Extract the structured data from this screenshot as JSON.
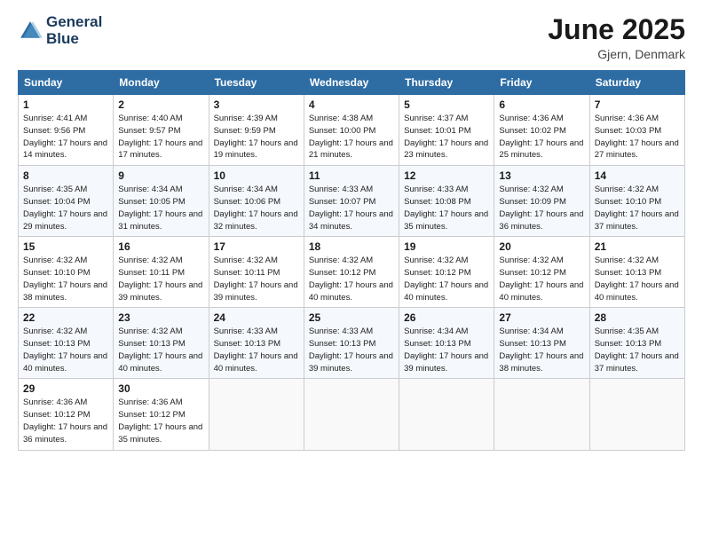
{
  "logo": {
    "line1": "General",
    "line2": "Blue"
  },
  "title": "June 2025",
  "location": "Gjern, Denmark",
  "weekdays": [
    "Sunday",
    "Monday",
    "Tuesday",
    "Wednesday",
    "Thursday",
    "Friday",
    "Saturday"
  ],
  "weeks": [
    [
      {
        "day": 1,
        "sunrise": "4:41 AM",
        "sunset": "9:56 PM",
        "daylight": "17 hours and 14 minutes."
      },
      {
        "day": 2,
        "sunrise": "4:40 AM",
        "sunset": "9:57 PM",
        "daylight": "17 hours and 17 minutes."
      },
      {
        "day": 3,
        "sunrise": "4:39 AM",
        "sunset": "9:59 PM",
        "daylight": "17 hours and 19 minutes."
      },
      {
        "day": 4,
        "sunrise": "4:38 AM",
        "sunset": "10:00 PM",
        "daylight": "17 hours and 21 minutes."
      },
      {
        "day": 5,
        "sunrise": "4:37 AM",
        "sunset": "10:01 PM",
        "daylight": "17 hours and 23 minutes."
      },
      {
        "day": 6,
        "sunrise": "4:36 AM",
        "sunset": "10:02 PM",
        "daylight": "17 hours and 25 minutes."
      },
      {
        "day": 7,
        "sunrise": "4:36 AM",
        "sunset": "10:03 PM",
        "daylight": "17 hours and 27 minutes."
      }
    ],
    [
      {
        "day": 8,
        "sunrise": "4:35 AM",
        "sunset": "10:04 PM",
        "daylight": "17 hours and 29 minutes."
      },
      {
        "day": 9,
        "sunrise": "4:34 AM",
        "sunset": "10:05 PM",
        "daylight": "17 hours and 31 minutes."
      },
      {
        "day": 10,
        "sunrise": "4:34 AM",
        "sunset": "10:06 PM",
        "daylight": "17 hours and 32 minutes."
      },
      {
        "day": 11,
        "sunrise": "4:33 AM",
        "sunset": "10:07 PM",
        "daylight": "17 hours and 34 minutes."
      },
      {
        "day": 12,
        "sunrise": "4:33 AM",
        "sunset": "10:08 PM",
        "daylight": "17 hours and 35 minutes."
      },
      {
        "day": 13,
        "sunrise": "4:32 AM",
        "sunset": "10:09 PM",
        "daylight": "17 hours and 36 minutes."
      },
      {
        "day": 14,
        "sunrise": "4:32 AM",
        "sunset": "10:10 PM",
        "daylight": "17 hours and 37 minutes."
      }
    ],
    [
      {
        "day": 15,
        "sunrise": "4:32 AM",
        "sunset": "10:10 PM",
        "daylight": "17 hours and 38 minutes."
      },
      {
        "day": 16,
        "sunrise": "4:32 AM",
        "sunset": "10:11 PM",
        "daylight": "17 hours and 39 minutes."
      },
      {
        "day": 17,
        "sunrise": "4:32 AM",
        "sunset": "10:11 PM",
        "daylight": "17 hours and 39 minutes."
      },
      {
        "day": 18,
        "sunrise": "4:32 AM",
        "sunset": "10:12 PM",
        "daylight": "17 hours and 40 minutes."
      },
      {
        "day": 19,
        "sunrise": "4:32 AM",
        "sunset": "10:12 PM",
        "daylight": "17 hours and 40 minutes."
      },
      {
        "day": 20,
        "sunrise": "4:32 AM",
        "sunset": "10:12 PM",
        "daylight": "17 hours and 40 minutes."
      },
      {
        "day": 21,
        "sunrise": "4:32 AM",
        "sunset": "10:13 PM",
        "daylight": "17 hours and 40 minutes."
      }
    ],
    [
      {
        "day": 22,
        "sunrise": "4:32 AM",
        "sunset": "10:13 PM",
        "daylight": "17 hours and 40 minutes."
      },
      {
        "day": 23,
        "sunrise": "4:32 AM",
        "sunset": "10:13 PM",
        "daylight": "17 hours and 40 minutes."
      },
      {
        "day": 24,
        "sunrise": "4:33 AM",
        "sunset": "10:13 PM",
        "daylight": "17 hours and 40 minutes."
      },
      {
        "day": 25,
        "sunrise": "4:33 AM",
        "sunset": "10:13 PM",
        "daylight": "17 hours and 39 minutes."
      },
      {
        "day": 26,
        "sunrise": "4:34 AM",
        "sunset": "10:13 PM",
        "daylight": "17 hours and 39 minutes."
      },
      {
        "day": 27,
        "sunrise": "4:34 AM",
        "sunset": "10:13 PM",
        "daylight": "17 hours and 38 minutes."
      },
      {
        "day": 28,
        "sunrise": "4:35 AM",
        "sunset": "10:13 PM",
        "daylight": "17 hours and 37 minutes."
      }
    ],
    [
      {
        "day": 29,
        "sunrise": "4:36 AM",
        "sunset": "10:12 PM",
        "daylight": "17 hours and 36 minutes."
      },
      {
        "day": 30,
        "sunrise": "4:36 AM",
        "sunset": "10:12 PM",
        "daylight": "17 hours and 35 minutes."
      },
      null,
      null,
      null,
      null,
      null
    ]
  ]
}
